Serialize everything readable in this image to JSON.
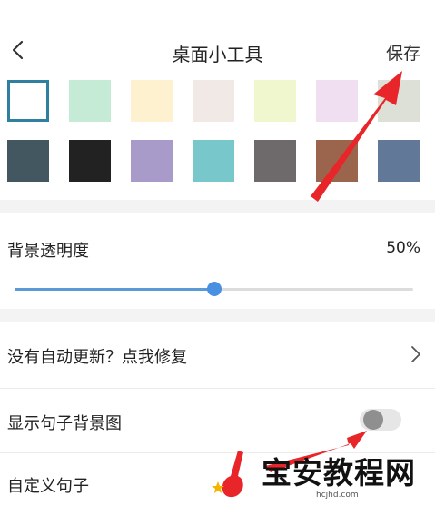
{
  "header": {
    "title": "桌面小工具",
    "save_label": "保存",
    "back_icon": "chevron-left-icon"
  },
  "palette": {
    "selected_index": 0,
    "row1": [
      "#ffffff",
      "#c5ead6",
      "#fdf1cf",
      "#f1e9e6",
      "#f0f7cf",
      "#efdff0",
      "#dde0d6"
    ],
    "row2": [
      "#42575f",
      "#222222",
      "#a89bc9",
      "#78c8cb",
      "#6e6a6c",
      "#9a654c",
      "#617898"
    ]
  },
  "opacity": {
    "label": "背景透明度",
    "value_text": "50%",
    "value": 0.5
  },
  "settings": {
    "auto_update_label": "没有自动更新？点我修复",
    "show_bg_label": "显示句子背景图",
    "show_bg_enabled": false,
    "custom_sentence_label": "自定义句子"
  },
  "colors": {
    "accent": "#4a90e2",
    "arrow": "#e8262a",
    "band": "#f3f3f3"
  },
  "watermark": {
    "text": "宝安教程网",
    "url": "hcjhd.com"
  }
}
